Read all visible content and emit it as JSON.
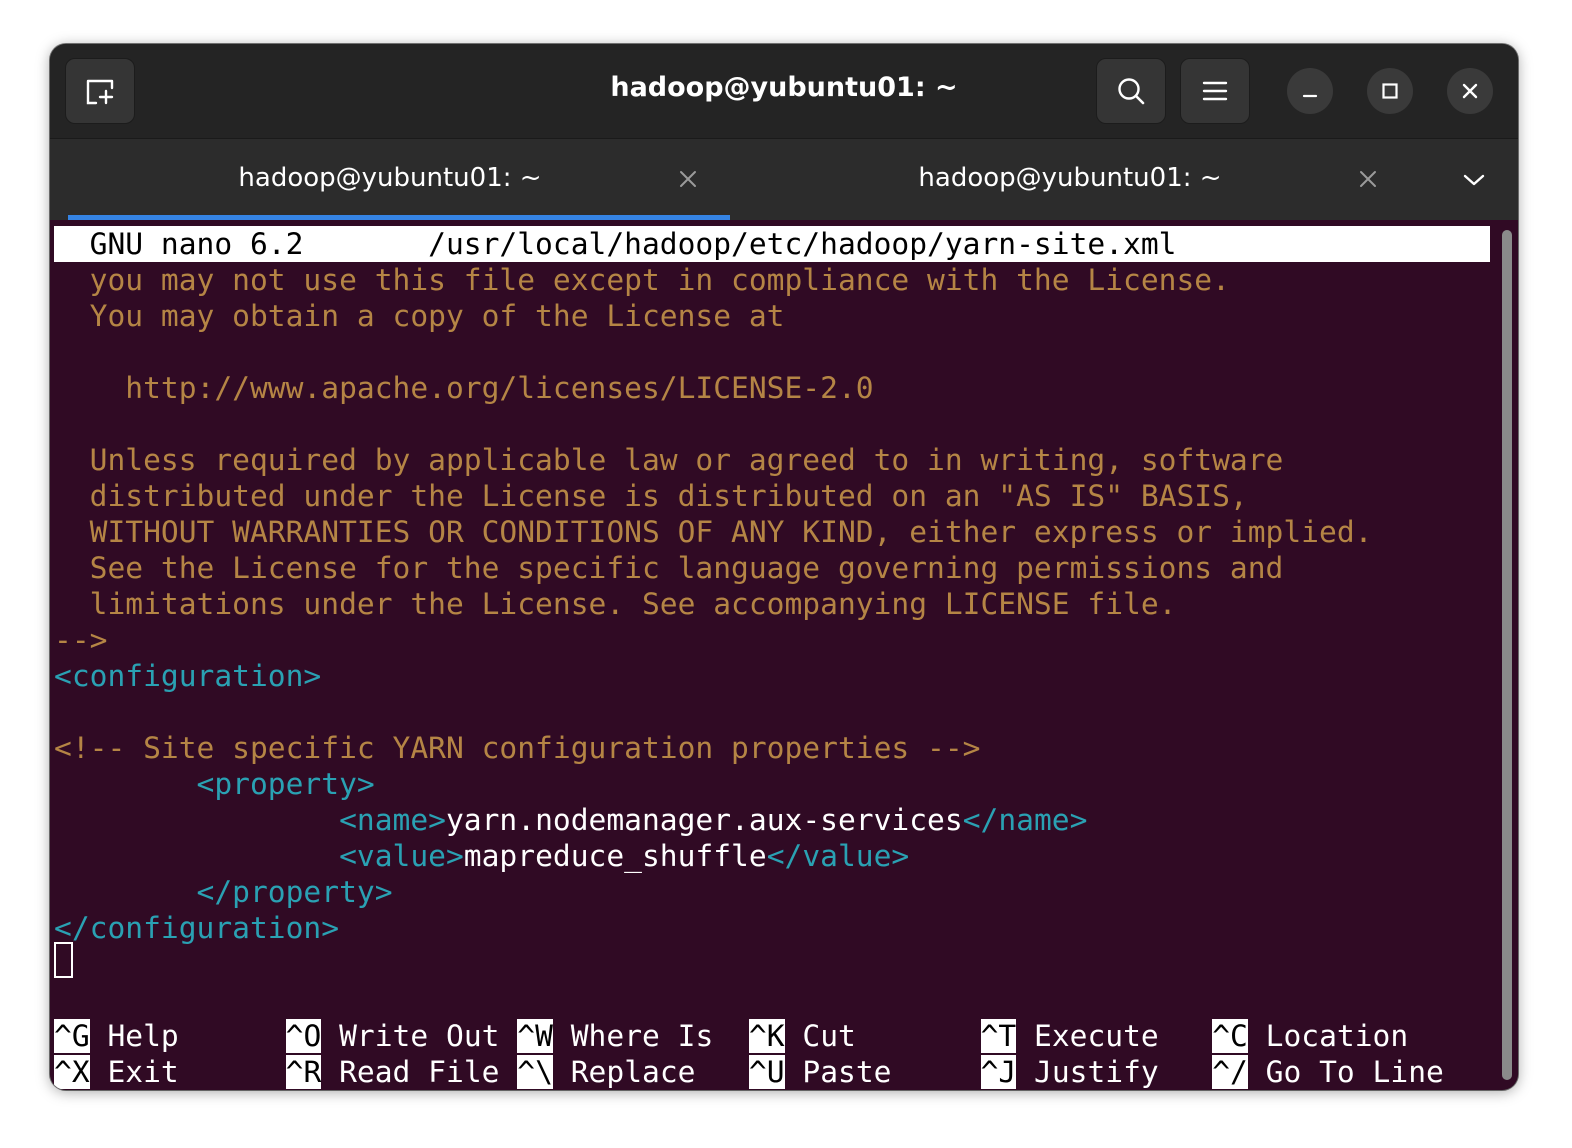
{
  "window": {
    "title": "hadoop@yubuntu01: ~"
  },
  "tabs": [
    {
      "label": "hadoop@yubuntu01: ~",
      "active": true
    },
    {
      "label": "hadoop@yubuntu01: ~",
      "active": false
    }
  ],
  "nano": {
    "status_left": "  GNU nano 6.2",
    "status_file": "/usr/local/hadoop/etc/hadoop/yarn-site.xml",
    "comment_lines": [
      "  you may not use this file except in compliance with the License.",
      "  You may obtain a copy of the License at",
      "    http://www.apache.org/licenses/LICENSE-2.0",
      "  Unless required by applicable law or agreed to in writing, software",
      "  distributed under the License is distributed on an \"AS IS\" BASIS,",
      "  WITHOUT WARRANTIES OR CONDITIONS OF ANY KIND, either express or implied.",
      "  See the License for the specific language governing permissions and",
      "  limitations under the License. See accompanying LICENSE file.",
      "-->"
    ],
    "xml": {
      "config_open": "<configuration>",
      "site_comment": "<!-- Site specific YARN configuration properties -->",
      "property_open": "        <property>",
      "name_indent": "                ",
      "name_open": "<name>",
      "name_value": "yarn.nodemanager.aux-services",
      "name_close": "</name>",
      "value_indent": "                ",
      "value_open": "<value>",
      "value_value": "mapreduce_shuffle",
      "value_close": "</value>",
      "property_close": "        </property>",
      "config_close": "</configuration>"
    },
    "shortcuts_row1": [
      {
        "key": "^G",
        "label": " Help      "
      },
      {
        "key": "^O",
        "label": " Write Out "
      },
      {
        "key": "^W",
        "label": " Where Is  "
      },
      {
        "key": "^K",
        "label": " Cut       "
      },
      {
        "key": "^T",
        "label": " Execute   "
      },
      {
        "key": "^C",
        "label": " Location"
      }
    ],
    "shortcuts_row2": [
      {
        "key": "^X",
        "label": " Exit      "
      },
      {
        "key": "^R",
        "label": " Read File "
      },
      {
        "key": "^\\",
        "label": " Replace   "
      },
      {
        "key": "^U",
        "label": " Paste     "
      },
      {
        "key": "^J",
        "label": " Justify   "
      },
      {
        "key": "^/",
        "label": " Go To Line"
      }
    ]
  },
  "icons": {
    "new_tab": "new-tab-icon",
    "search": "search-icon",
    "menu": "hamburger-menu-icon",
    "minimize": "minimize-icon",
    "maximize": "maximize-icon",
    "close": "close-icon",
    "tab_close": "tab-close-icon",
    "tab_dropdown": "chevron-down-icon"
  }
}
